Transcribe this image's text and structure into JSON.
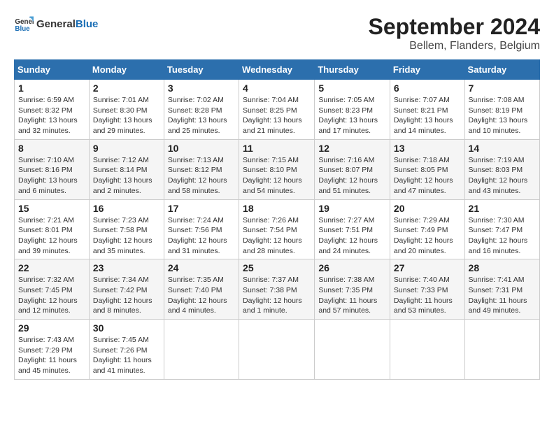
{
  "header": {
    "logo_line1": "General",
    "logo_line2": "Blue",
    "month_title": "September 2024",
    "location": "Bellem, Flanders, Belgium"
  },
  "weekdays": [
    "Sunday",
    "Monday",
    "Tuesday",
    "Wednesday",
    "Thursday",
    "Friday",
    "Saturday"
  ],
  "weeks": [
    [
      {
        "day": "1",
        "info": "Sunrise: 6:59 AM\nSunset: 8:32 PM\nDaylight: 13 hours\nand 32 minutes."
      },
      {
        "day": "2",
        "info": "Sunrise: 7:01 AM\nSunset: 8:30 PM\nDaylight: 13 hours\nand 29 minutes."
      },
      {
        "day": "3",
        "info": "Sunrise: 7:02 AM\nSunset: 8:28 PM\nDaylight: 13 hours\nand 25 minutes."
      },
      {
        "day": "4",
        "info": "Sunrise: 7:04 AM\nSunset: 8:25 PM\nDaylight: 13 hours\nand 21 minutes."
      },
      {
        "day": "5",
        "info": "Sunrise: 7:05 AM\nSunset: 8:23 PM\nDaylight: 13 hours\nand 17 minutes."
      },
      {
        "day": "6",
        "info": "Sunrise: 7:07 AM\nSunset: 8:21 PM\nDaylight: 13 hours\nand 14 minutes."
      },
      {
        "day": "7",
        "info": "Sunrise: 7:08 AM\nSunset: 8:19 PM\nDaylight: 13 hours\nand 10 minutes."
      }
    ],
    [
      {
        "day": "8",
        "info": "Sunrise: 7:10 AM\nSunset: 8:16 PM\nDaylight: 13 hours\nand 6 minutes."
      },
      {
        "day": "9",
        "info": "Sunrise: 7:12 AM\nSunset: 8:14 PM\nDaylight: 13 hours\nand 2 minutes."
      },
      {
        "day": "10",
        "info": "Sunrise: 7:13 AM\nSunset: 8:12 PM\nDaylight: 12 hours\nand 58 minutes."
      },
      {
        "day": "11",
        "info": "Sunrise: 7:15 AM\nSunset: 8:10 PM\nDaylight: 12 hours\nand 54 minutes."
      },
      {
        "day": "12",
        "info": "Sunrise: 7:16 AM\nSunset: 8:07 PM\nDaylight: 12 hours\nand 51 minutes."
      },
      {
        "day": "13",
        "info": "Sunrise: 7:18 AM\nSunset: 8:05 PM\nDaylight: 12 hours\nand 47 minutes."
      },
      {
        "day": "14",
        "info": "Sunrise: 7:19 AM\nSunset: 8:03 PM\nDaylight: 12 hours\nand 43 minutes."
      }
    ],
    [
      {
        "day": "15",
        "info": "Sunrise: 7:21 AM\nSunset: 8:01 PM\nDaylight: 12 hours\nand 39 minutes."
      },
      {
        "day": "16",
        "info": "Sunrise: 7:23 AM\nSunset: 7:58 PM\nDaylight: 12 hours\nand 35 minutes."
      },
      {
        "day": "17",
        "info": "Sunrise: 7:24 AM\nSunset: 7:56 PM\nDaylight: 12 hours\nand 31 minutes."
      },
      {
        "day": "18",
        "info": "Sunrise: 7:26 AM\nSunset: 7:54 PM\nDaylight: 12 hours\nand 28 minutes."
      },
      {
        "day": "19",
        "info": "Sunrise: 7:27 AM\nSunset: 7:51 PM\nDaylight: 12 hours\nand 24 minutes."
      },
      {
        "day": "20",
        "info": "Sunrise: 7:29 AM\nSunset: 7:49 PM\nDaylight: 12 hours\nand 20 minutes."
      },
      {
        "day": "21",
        "info": "Sunrise: 7:30 AM\nSunset: 7:47 PM\nDaylight: 12 hours\nand 16 minutes."
      }
    ],
    [
      {
        "day": "22",
        "info": "Sunrise: 7:32 AM\nSunset: 7:45 PM\nDaylight: 12 hours\nand 12 minutes."
      },
      {
        "day": "23",
        "info": "Sunrise: 7:34 AM\nSunset: 7:42 PM\nDaylight: 12 hours\nand 8 minutes."
      },
      {
        "day": "24",
        "info": "Sunrise: 7:35 AM\nSunset: 7:40 PM\nDaylight: 12 hours\nand 4 minutes."
      },
      {
        "day": "25",
        "info": "Sunrise: 7:37 AM\nSunset: 7:38 PM\nDaylight: 12 hours\nand 1 minute."
      },
      {
        "day": "26",
        "info": "Sunrise: 7:38 AM\nSunset: 7:35 PM\nDaylight: 11 hours\nand 57 minutes."
      },
      {
        "day": "27",
        "info": "Sunrise: 7:40 AM\nSunset: 7:33 PM\nDaylight: 11 hours\nand 53 minutes."
      },
      {
        "day": "28",
        "info": "Sunrise: 7:41 AM\nSunset: 7:31 PM\nDaylight: 11 hours\nand 49 minutes."
      }
    ],
    [
      {
        "day": "29",
        "info": "Sunrise: 7:43 AM\nSunset: 7:29 PM\nDaylight: 11 hours\nand 45 minutes."
      },
      {
        "day": "30",
        "info": "Sunrise: 7:45 AM\nSunset: 7:26 PM\nDaylight: 11 hours\nand 41 minutes."
      },
      {
        "day": "",
        "info": ""
      },
      {
        "day": "",
        "info": ""
      },
      {
        "day": "",
        "info": ""
      },
      {
        "day": "",
        "info": ""
      },
      {
        "day": "",
        "info": ""
      }
    ]
  ]
}
